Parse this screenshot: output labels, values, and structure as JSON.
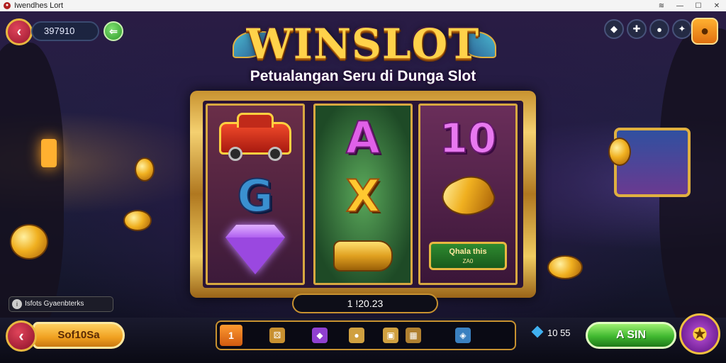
{
  "window": {
    "title": "Iwendhes Lort"
  },
  "header": {
    "balance": "397910",
    "logo": "WINSLOT",
    "subtitle": "Petualangan Seru di Dunga Slot"
  },
  "reels": {
    "plaque_line1": "Qhala this",
    "plaque_line2": "ZA0",
    "letter_g": "G",
    "letter_a": "A",
    "letter_x": "X",
    "number_ten": "10"
  },
  "win_display": "1 !20.23",
  "info_text": "Isfots Gyaenbterks",
  "bottom": {
    "select_label": "Sof10Sa",
    "toolbar_first": "1",
    "gem_count": "10 55",
    "spin_label": "A SIN"
  },
  "colors": {
    "accent_gold": "#e8b840",
    "spin_green": "#40b830",
    "back_red": "#c02040"
  }
}
